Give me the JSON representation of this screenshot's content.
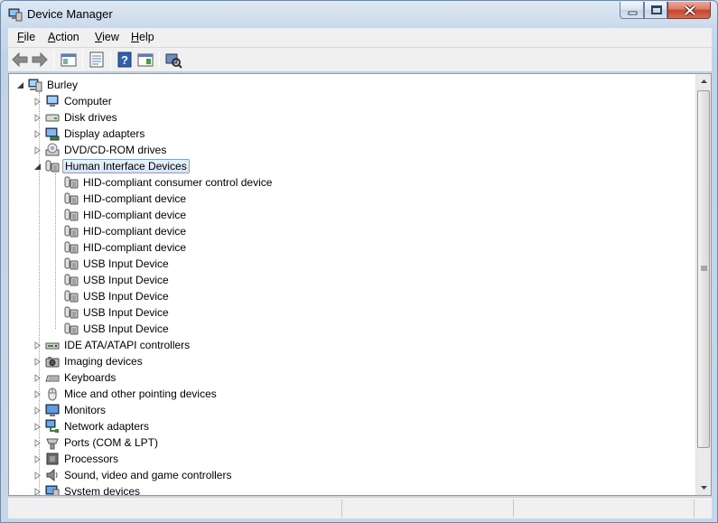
{
  "window": {
    "title": "Device Manager"
  },
  "menu": {
    "items": [
      {
        "accel": "F",
        "rest": "ile"
      },
      {
        "accel": "A",
        "rest": "ction"
      },
      {
        "accel": "V",
        "rest": "iew"
      },
      {
        "accel": "H",
        "rest": "elp"
      }
    ]
  },
  "toolbar": {
    "buttons": [
      "back-arrow-icon",
      "forward-arrow-icon",
      "show-hide-console-tree-icon",
      "properties-icon",
      "help-icon",
      "action-pane-icon",
      "scan-hardware-changes-icon"
    ]
  },
  "tree": {
    "root": "Burley",
    "categories": [
      {
        "label": "Computer",
        "icon": "computer-icon",
        "expanded": false
      },
      {
        "label": "Disk drives",
        "icon": "disk-drive-icon",
        "expanded": false
      },
      {
        "label": "Display adapters",
        "icon": "display-adapter-icon",
        "expanded": false
      },
      {
        "label": "DVD/CD-ROM drives",
        "icon": "dvd-drive-icon",
        "expanded": false
      },
      {
        "label": "Human Interface Devices",
        "icon": "hid-icon",
        "expanded": true,
        "selected": true,
        "children": [
          "HID-compliant consumer control device",
          "HID-compliant device",
          "HID-compliant device",
          "HID-compliant device",
          "HID-compliant device",
          "USB Input Device",
          "USB Input Device",
          "USB Input Device",
          "USB Input Device",
          "USB Input Device"
        ]
      },
      {
        "label": "IDE ATA/ATAPI controllers",
        "icon": "ide-controller-icon",
        "expanded": false
      },
      {
        "label": "Imaging devices",
        "icon": "camera-icon",
        "expanded": false
      },
      {
        "label": "Keyboards",
        "icon": "keyboard-icon",
        "expanded": false
      },
      {
        "label": "Mice and other pointing devices",
        "icon": "mouse-icon",
        "expanded": false
      },
      {
        "label": "Monitors",
        "icon": "monitor-icon",
        "expanded": false
      },
      {
        "label": "Network adapters",
        "icon": "network-adapter-icon",
        "expanded": false
      },
      {
        "label": "Ports (COM & LPT)",
        "icon": "port-icon",
        "expanded": false
      },
      {
        "label": "Processors",
        "icon": "processor-icon",
        "expanded": false
      },
      {
        "label": "Sound, video and game controllers",
        "icon": "speaker-icon",
        "expanded": false
      },
      {
        "label": "System devices",
        "icon": "system-devices-icon",
        "expanded": false
      }
    ]
  },
  "colors": {
    "selection_border": "#7da2ce",
    "selection_fill": "#d5e5f7",
    "close_red": "#c6452e"
  }
}
